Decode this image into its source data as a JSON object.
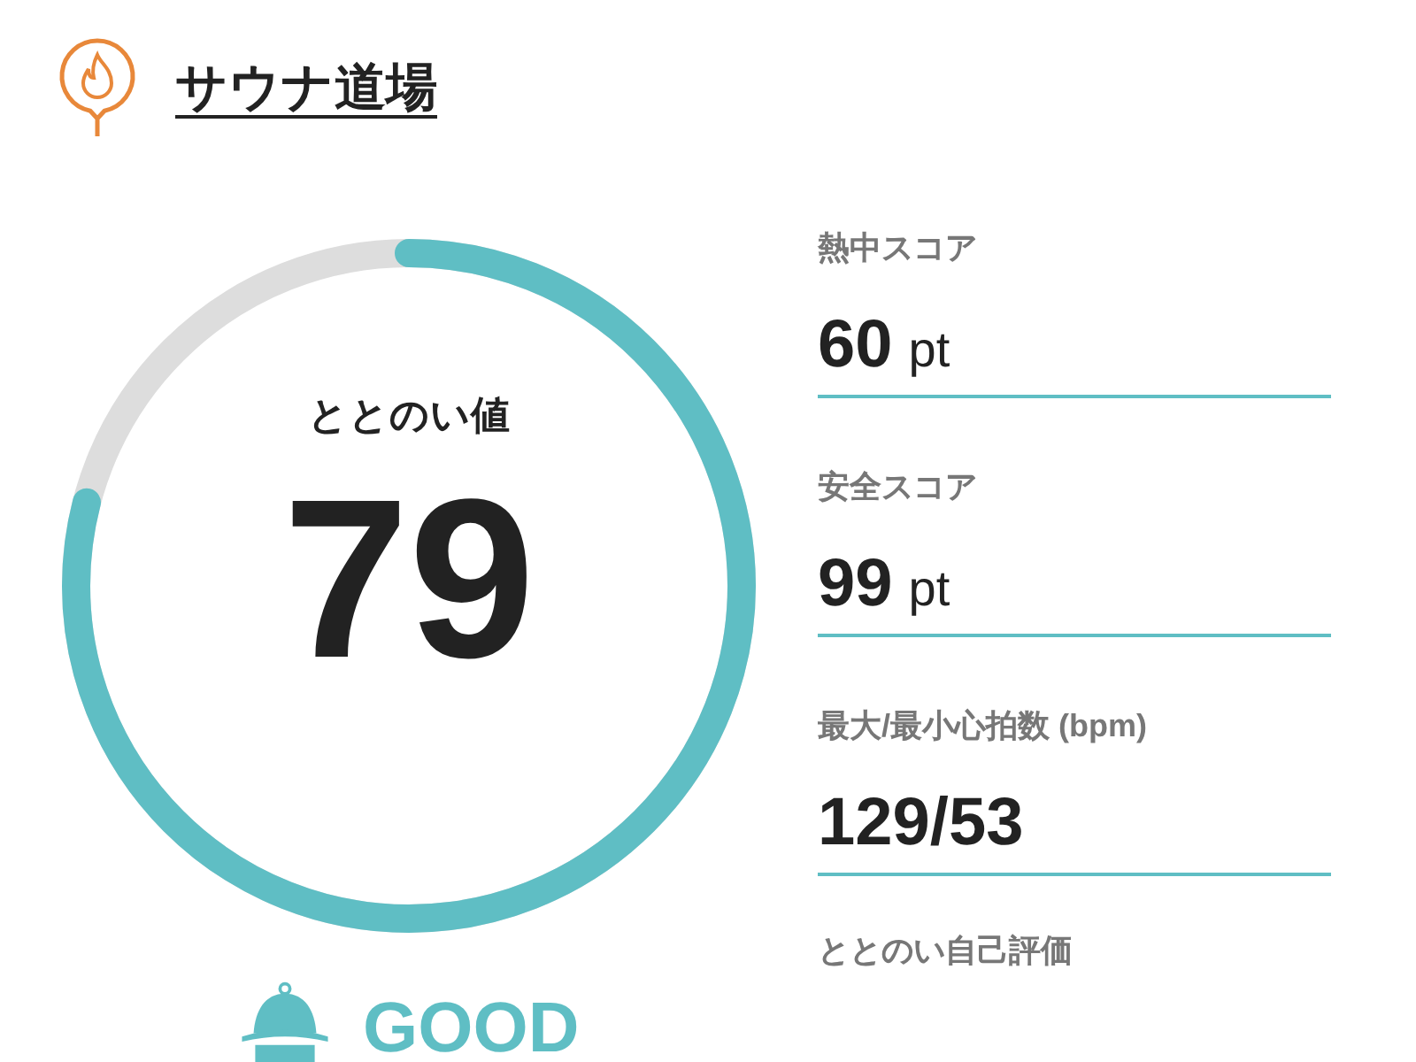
{
  "header": {
    "title": "サウナ道場"
  },
  "gauge": {
    "label": "ととのい値",
    "value": "79",
    "level": 0.79
  },
  "rating": {
    "text": "GOOD"
  },
  "metrics": [
    {
      "label": "熱中スコア",
      "value": "60",
      "unit": "pt"
    },
    {
      "label": "安全スコア",
      "value": "99",
      "unit": "pt"
    },
    {
      "label": "最大/最小心拍数 (bpm)",
      "value": "129/53"
    }
  ],
  "self_rating": {
    "label": "ととのい自己評価"
  }
}
